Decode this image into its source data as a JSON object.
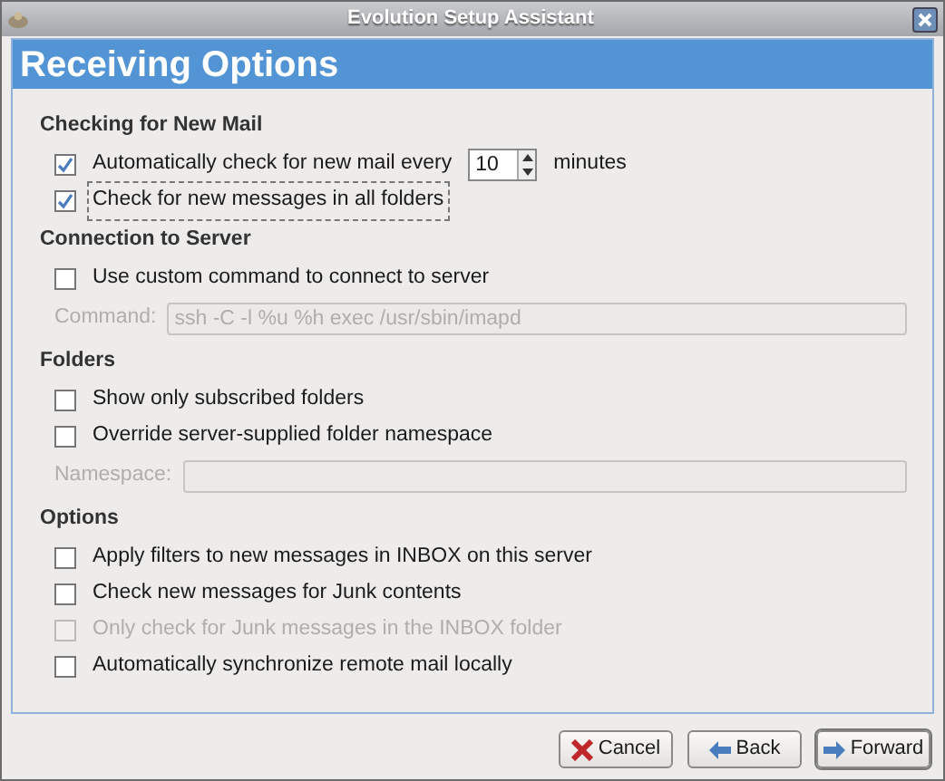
{
  "window": {
    "title": "Evolution Setup Assistant"
  },
  "page_title": "Receiving Options",
  "sections": [
    {
      "title": "Checking for New Mail",
      "items": [
        {
          "kind": "spin",
          "label": "Automatically check for new mail every",
          "checked": true,
          "disabled": false,
          "focused": false,
          "value": "10",
          "suffix": "minutes"
        },
        {
          "kind": "checkbox",
          "label": "Check for new messages in all folders",
          "checked": true,
          "disabled": false,
          "focused": true
        }
      ]
    },
    {
      "title": "Connection to Server",
      "items": [
        {
          "kind": "checkbox",
          "label": "Use custom command to connect to server",
          "checked": false,
          "disabled": false,
          "focused": false
        },
        {
          "kind": "field",
          "label": "Command:",
          "value": "ssh -C -l %u %h exec /usr/sbin/imapd",
          "disabled": true
        }
      ]
    },
    {
      "title": "Folders",
      "items": [
        {
          "kind": "checkbox",
          "label": "Show only subscribed folders",
          "checked": false,
          "disabled": false,
          "focused": false
        },
        {
          "kind": "checkbox",
          "label": "Override server-supplied folder namespace",
          "checked": false,
          "disabled": false,
          "focused": false
        },
        {
          "kind": "field",
          "label": "Namespace:",
          "disabled": true
        }
      ]
    },
    {
      "title": "Options",
      "items": [
        {
          "kind": "checkbox",
          "label": "Apply filters to new messages in INBOX on this server",
          "checked": false,
          "disabled": false,
          "focused": false
        },
        {
          "kind": "checkbox",
          "label": "Check new messages for Junk contents",
          "checked": false,
          "disabled": false,
          "focused": false
        },
        {
          "kind": "checkbox",
          "label": "Only check for Junk messages in the INBOX folder",
          "checked": false,
          "disabled": true,
          "focused": false
        },
        {
          "kind": "checkbox",
          "label": "Automatically synchronize remote mail locally",
          "checked": false,
          "disabled": false,
          "focused": false
        }
      ]
    }
  ],
  "buttons": [
    {
      "kind": "cancel",
      "label": "Cancel",
      "focused": false
    },
    {
      "kind": "back",
      "label": "Back",
      "focused": false
    },
    {
      "kind": "forward",
      "label": "Forward",
      "focused": true
    }
  ]
}
